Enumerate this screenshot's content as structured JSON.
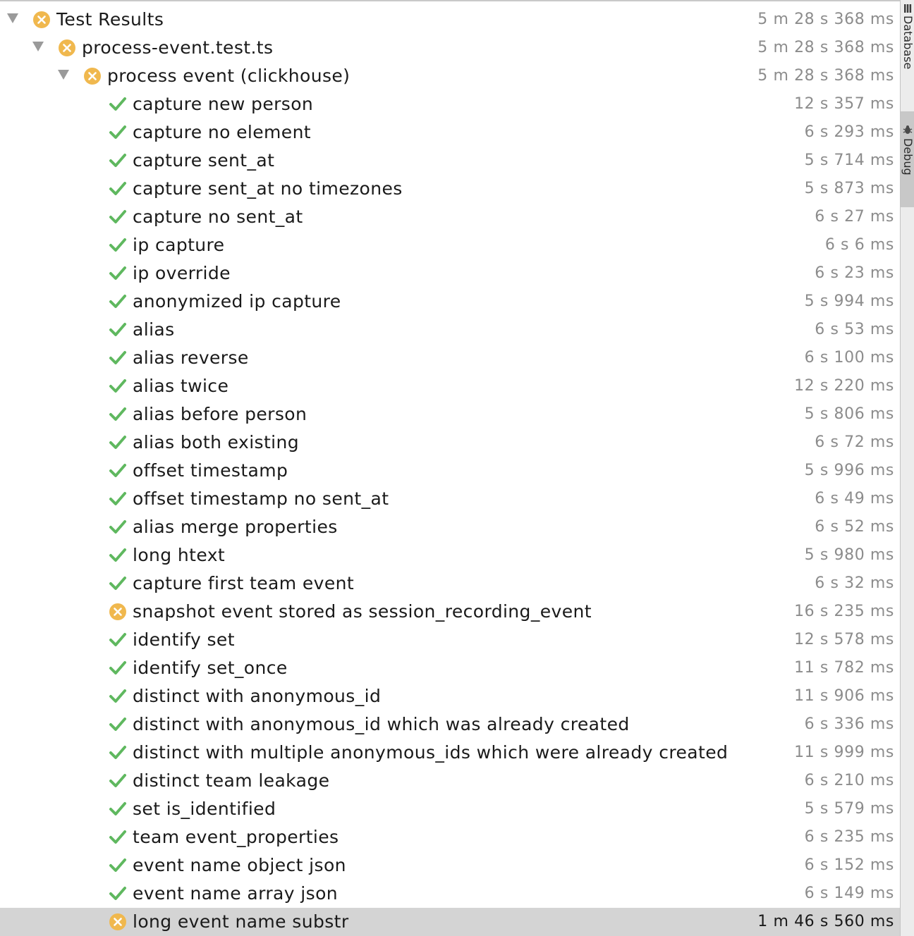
{
  "colors": {
    "pass": "#5fb85f",
    "fail": "#f0b84e",
    "selected_row": "#d4d4d4"
  },
  "rows": [
    {
      "label": "Test Results",
      "duration": "5 m 28 s 368 ms",
      "status": "fail",
      "level": 0,
      "expanded": true,
      "selected": false
    },
    {
      "label": "process-event.test.ts",
      "duration": "5 m 28 s 368 ms",
      "status": "fail",
      "level": 1,
      "expanded": true,
      "selected": false
    },
    {
      "label": "process event (clickhouse)",
      "duration": "5 m 28 s 368 ms",
      "status": "fail",
      "level": 2,
      "expanded": true,
      "selected": false
    },
    {
      "label": "capture new person",
      "duration": "12 s 357 ms",
      "status": "pass",
      "level": 3,
      "selected": false
    },
    {
      "label": "capture no element",
      "duration": "6 s 293 ms",
      "status": "pass",
      "level": 3,
      "selected": false
    },
    {
      "label": "capture sent_at",
      "duration": "5 s 714 ms",
      "status": "pass",
      "level": 3,
      "selected": false
    },
    {
      "label": "capture sent_at no timezones",
      "duration": "5 s 873 ms",
      "status": "pass",
      "level": 3,
      "selected": false
    },
    {
      "label": "capture no sent_at",
      "duration": "6 s 27 ms",
      "status": "pass",
      "level": 3,
      "selected": false
    },
    {
      "label": "ip capture",
      "duration": "6 s 6 ms",
      "status": "pass",
      "level": 3,
      "selected": false
    },
    {
      "label": "ip override",
      "duration": "6 s 23 ms",
      "status": "pass",
      "level": 3,
      "selected": false
    },
    {
      "label": "anonymized ip capture",
      "duration": "5 s 994 ms",
      "status": "pass",
      "level": 3,
      "selected": false
    },
    {
      "label": "alias",
      "duration": "6 s 53 ms",
      "status": "pass",
      "level": 3,
      "selected": false
    },
    {
      "label": "alias reverse",
      "duration": "6 s 100 ms",
      "status": "pass",
      "level": 3,
      "selected": false
    },
    {
      "label": "alias twice",
      "duration": "12 s 220 ms",
      "status": "pass",
      "level": 3,
      "selected": false
    },
    {
      "label": "alias before person",
      "duration": "5 s 806 ms",
      "status": "pass",
      "level": 3,
      "selected": false
    },
    {
      "label": "alias both existing",
      "duration": "6 s 72 ms",
      "status": "pass",
      "level": 3,
      "selected": false
    },
    {
      "label": "offset timestamp",
      "duration": "5 s 996 ms",
      "status": "pass",
      "level": 3,
      "selected": false
    },
    {
      "label": "offset timestamp no sent_at",
      "duration": "6 s 49 ms",
      "status": "pass",
      "level": 3,
      "selected": false
    },
    {
      "label": "alias merge properties",
      "duration": "6 s 52 ms",
      "status": "pass",
      "level": 3,
      "selected": false
    },
    {
      "label": "long htext",
      "duration": "5 s 980 ms",
      "status": "pass",
      "level": 3,
      "selected": false
    },
    {
      "label": "capture first team event",
      "duration": "6 s 32 ms",
      "status": "pass",
      "level": 3,
      "selected": false
    },
    {
      "label": "snapshot event stored as session_recording_event",
      "duration": "16 s 235 ms",
      "status": "fail",
      "level": 3,
      "selected": false
    },
    {
      "label": "identify set",
      "duration": "12 s 578 ms",
      "status": "pass",
      "level": 3,
      "selected": false
    },
    {
      "label": "identify set_once",
      "duration": "11 s 782 ms",
      "status": "pass",
      "level": 3,
      "selected": false
    },
    {
      "label": "distinct with anonymous_id",
      "duration": "11 s 906 ms",
      "status": "pass",
      "level": 3,
      "selected": false
    },
    {
      "label": "distinct with anonymous_id which was already created",
      "duration": "6 s 336 ms",
      "status": "pass",
      "level": 3,
      "selected": false
    },
    {
      "label": "distinct with multiple anonymous_ids which were already created",
      "duration": "11 s 999 ms",
      "status": "pass",
      "level": 3,
      "selected": false
    },
    {
      "label": "distinct team leakage",
      "duration": "6 s 210 ms",
      "status": "pass",
      "level": 3,
      "selected": false
    },
    {
      "label": "set is_identified",
      "duration": "5 s 579 ms",
      "status": "pass",
      "level": 3,
      "selected": false
    },
    {
      "label": "team event_properties",
      "duration": "6 s 235 ms",
      "status": "pass",
      "level": 3,
      "selected": false
    },
    {
      "label": "event name object json",
      "duration": "6 s 152 ms",
      "status": "pass",
      "level": 3,
      "selected": false
    },
    {
      "label": "event name array json",
      "duration": "6 s 149 ms",
      "status": "pass",
      "level": 3,
      "selected": false
    },
    {
      "label": "long event name substr",
      "duration": "1 m 46 s 560 ms",
      "status": "fail",
      "level": 3,
      "selected": true
    }
  ],
  "side_tabs": [
    {
      "label": "Database",
      "icon": "database-icon",
      "active": false
    },
    {
      "label": "Debug",
      "icon": "debug-icon",
      "active": true
    }
  ]
}
